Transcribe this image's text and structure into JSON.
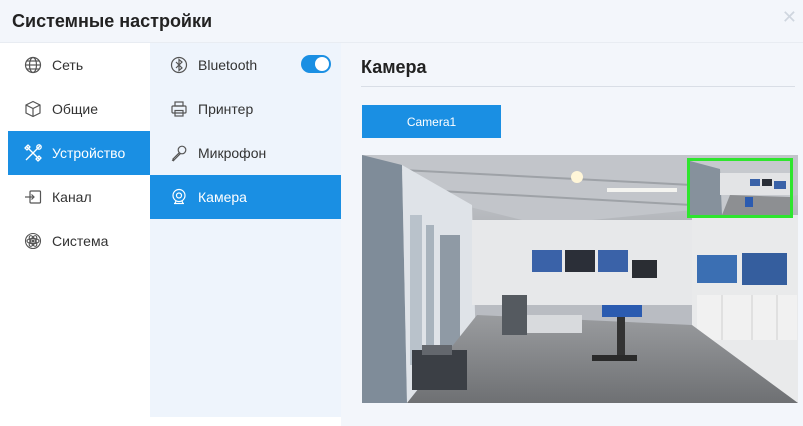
{
  "window": {
    "title": "Системные настройки",
    "close_icon": "close-icon"
  },
  "nav_primary": {
    "items": [
      {
        "label": "Сеть",
        "icon": "globe-icon",
        "active": false
      },
      {
        "label": "Общие",
        "icon": "cube-icon",
        "active": false
      },
      {
        "label": "Устройство",
        "icon": "tools-icon",
        "active": true
      },
      {
        "label": "Канал",
        "icon": "input-icon",
        "active": false
      },
      {
        "label": "Система",
        "icon": "atom-icon",
        "active": false
      }
    ]
  },
  "nav_secondary": {
    "items": [
      {
        "label": "Bluetooth",
        "icon": "bluetooth-icon",
        "active": false,
        "toggle_on": true
      },
      {
        "label": "Принтер",
        "icon": "printer-icon",
        "active": false
      },
      {
        "label": "Микрофон",
        "icon": "microphone-icon",
        "active": false
      },
      {
        "label": "Камера",
        "icon": "camera-icon",
        "active": true
      }
    ]
  },
  "content": {
    "title": "Камера",
    "camera_button": "Camera1",
    "preview_description_icon": "camera-preview"
  },
  "colors": {
    "accent": "#1a8fe3",
    "secondary_bg": "#eef4fc",
    "pip_border": "#2ee52e"
  }
}
